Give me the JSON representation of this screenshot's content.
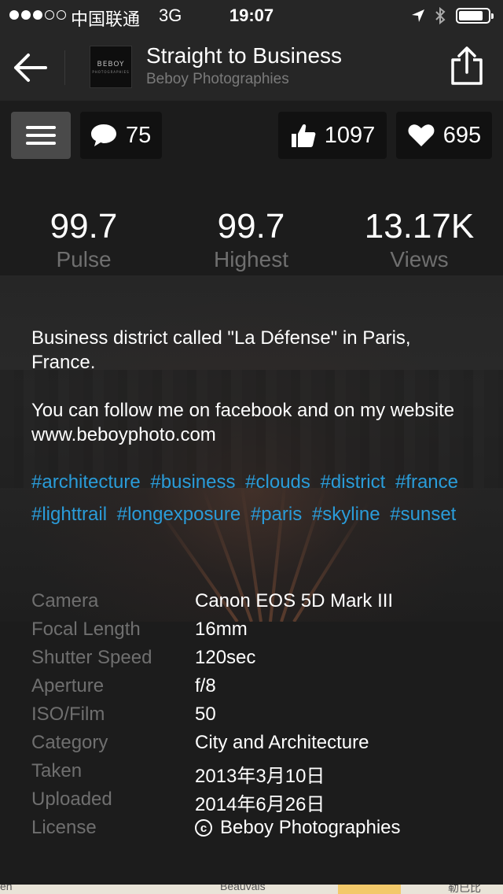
{
  "status_bar": {
    "carrier": "中国联通",
    "network": "3G",
    "time": "19:07"
  },
  "nav": {
    "title": "Straight to Business",
    "subtitle": "Beboy Photographies",
    "thumb_text": "BEBOY",
    "thumb_subtext": "PHOTOGRAPHIES"
  },
  "actions": {
    "comments_count": "75",
    "likes_count": "1097",
    "favorites_count": "695"
  },
  "stats": [
    {
      "value": "99.7",
      "label": "Pulse"
    },
    {
      "value": "99.7",
      "label": "Highest"
    },
    {
      "value": "13.17K",
      "label": "Views"
    }
  ],
  "description": {
    "line1": "Business district called \"La Défense\" in Paris, France.",
    "line2": "You can follow me on facebook and on my website www.beboyphoto.com"
  },
  "tags": [
    "#architecture",
    "#business",
    "#clouds",
    "#district",
    "#france",
    "#lighttrail",
    "#longexposure",
    "#paris",
    "#skyline",
    "#sunset"
  ],
  "details": [
    {
      "key": "Camera",
      "value": "Canon EOS 5D Mark III"
    },
    {
      "key": "Focal Length",
      "value": "16mm"
    },
    {
      "key": "Shutter Speed",
      "value": "120sec"
    },
    {
      "key": "Aperture",
      "value": "f/8"
    },
    {
      "key": "ISO/Film",
      "value": "50"
    },
    {
      "key": "Category",
      "value": "City and Architecture"
    },
    {
      "key": "Taken",
      "value": "2013年3月10日"
    },
    {
      "key": "Uploaded",
      "value": "2014年6月26日"
    },
    {
      "key": "License",
      "value": "Beboy Photographies"
    }
  ],
  "license_symbol": "c",
  "map": {
    "left_text": "en",
    "city": "Beauvais",
    "right_text": "勒已比"
  },
  "colors": {
    "hashtag": "#2a9cd9",
    "muted": "#6f6f6f",
    "background": "#1c1c1c"
  }
}
